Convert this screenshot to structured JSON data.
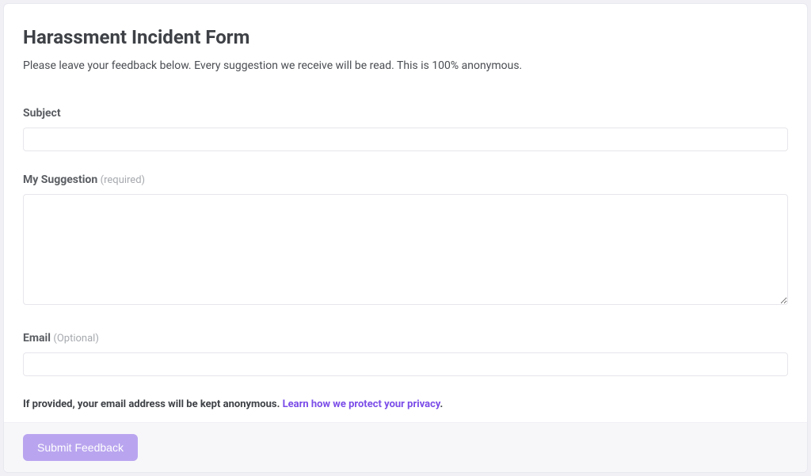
{
  "form": {
    "title": "Harassment Incident Form",
    "subtitle": "Please leave your feedback below. Every suggestion we receive will be read. This is 100% anonymous.",
    "fields": {
      "subject": {
        "label": "Subject",
        "value": ""
      },
      "suggestion": {
        "label": "My Suggestion",
        "hint": "(required)",
        "value": ""
      },
      "email": {
        "label": "Email",
        "hint": "(Optional)",
        "value": ""
      }
    },
    "privacy": {
      "text": "If provided, your email address will be kept anonymous. ",
      "link_text": "Learn how we protect your privacy",
      "period": "."
    },
    "submit_label": "Submit Feedback"
  }
}
